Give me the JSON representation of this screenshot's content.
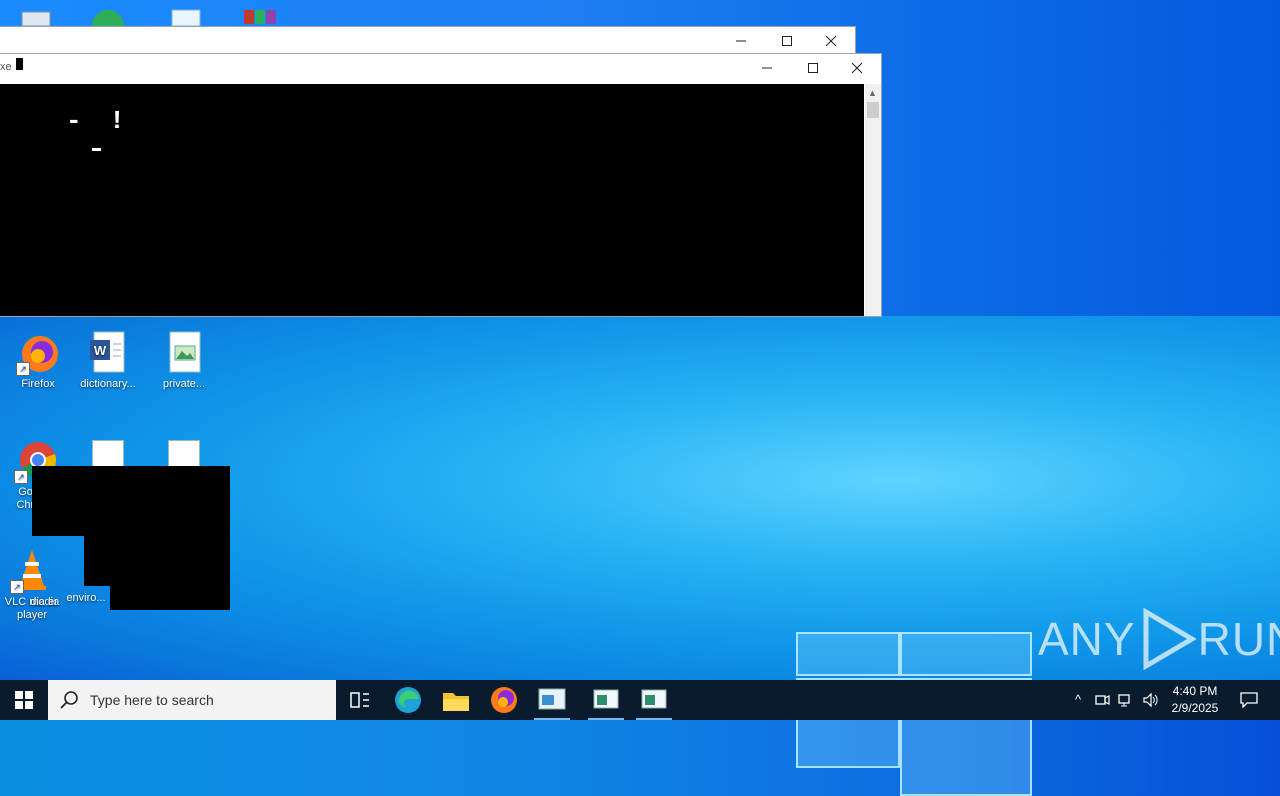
{
  "console_window": {
    "title": "xe",
    "controls": {
      "minimize": "─",
      "maximize": "☐",
      "close": "✕"
    },
    "console_text": "- !"
  },
  "back_window": {
    "controls": {
      "minimize": "─",
      "maximize": "☐",
      "close": "✕"
    }
  },
  "desktop_icons": [
    {
      "label": "Firefox",
      "icon": "firefox-icon"
    },
    {
      "label": "dictionary...",
      "icon": "word-document-icon"
    },
    {
      "label": "private...",
      "icon": "image-file-icon"
    },
    {
      "label": "Google Chrome",
      "icon": "chrome-icon"
    },
    {
      "label": "VLC media player",
      "icon": "vlc-icon"
    },
    {
      "label": "dia er",
      "icon": "image-file-icon"
    },
    {
      "label": "enviro...",
      "icon": "image-file-icon"
    }
  ],
  "taskbar": {
    "search_placeholder": "Type here to search",
    "apps": [
      {
        "name": "task-view",
        "icon": "task-view-icon"
      },
      {
        "name": "edge",
        "icon": "edge-icon"
      },
      {
        "name": "file-explorer",
        "icon": "folder-icon"
      },
      {
        "name": "firefox",
        "icon": "firefox-icon"
      },
      {
        "name": "window-app-1",
        "icon": "window-app-icon"
      },
      {
        "name": "window-app-2",
        "icon": "window-app-icon"
      },
      {
        "name": "window-app-3",
        "icon": "window-app-icon"
      }
    ],
    "time": "4:40 PM",
    "date": "2/9/2025"
  },
  "watermark": {
    "text_left": "ANY",
    "text_right": "RUN"
  },
  "colors": {
    "taskbar": "#0b1b2e",
    "accent": "#76b9ed",
    "console_bg": "#000000"
  }
}
